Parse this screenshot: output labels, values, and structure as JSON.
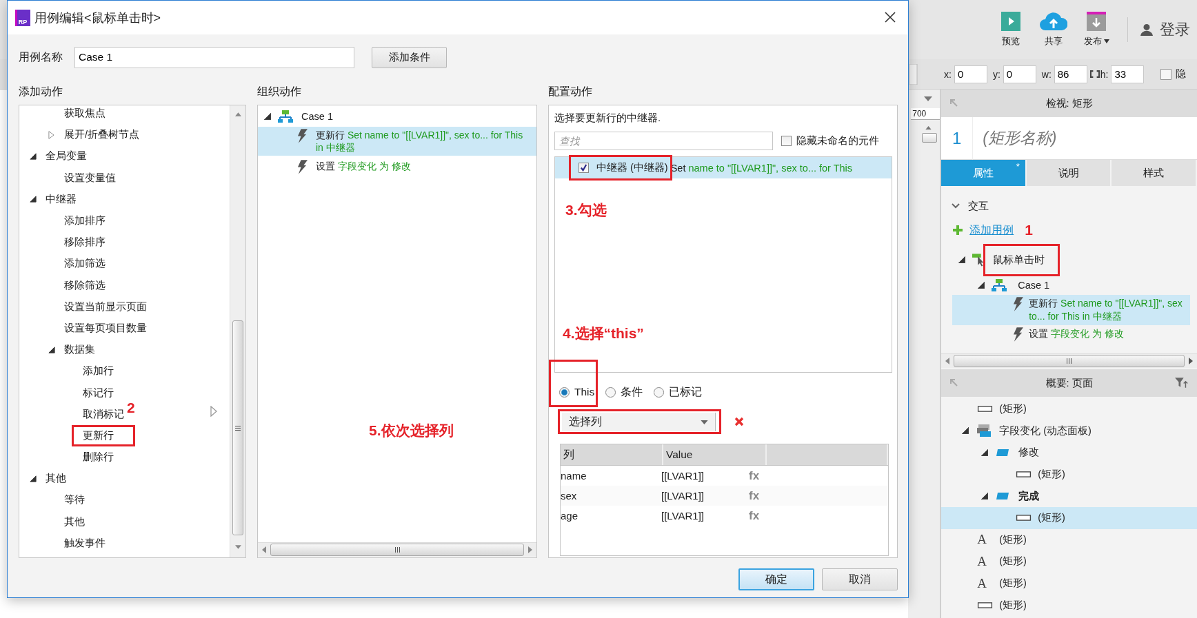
{
  "dialog": {
    "logo": "RP",
    "title": "用例编辑<鼠标单击时>",
    "name_label": "用例名称",
    "name_value": "Case 1",
    "add_condition": "添加条件",
    "add_actions": {
      "header": "添加动作",
      "tree": [
        {
          "children": [
            {
              "label": "获取焦点"
            },
            {
              "label": "展开/折叠树节点",
              "expanded": false
            }
          ]
        },
        {
          "label": "全局变量",
          "expanded": true,
          "children": [
            {
              "label": "设置变量值"
            }
          ]
        },
        {
          "label": "中继器",
          "expanded": true,
          "children": [
            {
              "label": "添加排序"
            },
            {
              "label": "移除排序"
            },
            {
              "label": "添加筛选"
            },
            {
              "label": "移除筛选"
            },
            {
              "label": "设置当前显示页面"
            },
            {
              "label": "设置每页项目数量"
            },
            {
              "label": "数据集",
              "expanded": true,
              "children": [
                {
                  "label": "添加行",
                  "marked": false
                },
                {
                  "label": "标记行",
                  "marked": false
                },
                {
                  "label": "取消标记",
                  "marked": false,
                  "callout": "2"
                },
                {
                  "label": "更新行",
                  "marked": true
                },
                {
                  "label": "删除行",
                  "marked": false
                }
              ]
            }
          ]
        },
        {
          "label": "其他",
          "expanded": true,
          "children": [
            {
              "label": "等待"
            },
            {
              "label": "其他"
            },
            {
              "label": "触发事件"
            }
          ]
        }
      ]
    },
    "organize": {
      "header": "组织动作",
      "case": {
        "label": "Case 1",
        "expanded": true,
        "actions": [
          {
            "verb": "更新行",
            "detail": "Set name to \"[[LVAR1]]\", sex to... for This in 中继器",
            "selected": true
          },
          {
            "verb": "设置",
            "detail": "字段变化 为 修改",
            "selected": false
          }
        ]
      }
    },
    "configure": {
      "header": "配置动作",
      "prompt": "选择要更新行的中继器.",
      "search": {
        "placeholder": "查找"
      },
      "hide_unnamed": {
        "label": "隐藏未命名的元件",
        "checked": false
      },
      "targets": [
        {
          "name": "中继器 (中继器)",
          "verb": "Set",
          "detail": "name to \"[[LVAR1]]\", sex to... for This",
          "checked": true,
          "selected": true,
          "marked": true
        }
      ],
      "scope": [
        {
          "label": "This",
          "selected": true,
          "marked": true
        },
        {
          "label": "条件",
          "selected": false,
          "marked": false
        },
        {
          "label": "已标记",
          "selected": false,
          "marked": false
        }
      ],
      "column_select": {
        "value": "选择列",
        "marked": true
      },
      "table": {
        "columns": [
          "列",
          "Value"
        ],
        "rows": [
          {
            "column": "name",
            "value": "[[LVAR1]]",
            "fx": "fx"
          },
          {
            "column": "sex",
            "value": "[[LVAR1]]",
            "fx": "fx"
          },
          {
            "column": "age",
            "value": "[[LVAR1]]",
            "fx": "fx"
          }
        ]
      }
    },
    "buttons": [
      {
        "label": "确定",
        "primary": true
      },
      {
        "label": "取消",
        "primary": false
      }
    ],
    "annotations": [
      "3.勾选",
      "4.选择“this”",
      "5.依次选择列"
    ]
  },
  "app": {
    "toolbar": [
      {
        "label": "预览",
        "kind": "preview",
        "menu": false
      },
      {
        "label": "共享",
        "kind": "share",
        "menu": false
      },
      {
        "label": "发布",
        "kind": "publish",
        "menu": true
      }
    ],
    "login": "登录",
    "geometry": [
      {
        "label": "x:",
        "value": "0",
        "lock": false
      },
      {
        "label": "y:",
        "value": "0",
        "lock": false
      },
      {
        "label": "w:",
        "value": "86",
        "lock": false
      },
      {
        "label": "h:",
        "value": "33",
        "lock": true
      }
    ],
    "hidden": {
      "label": "隐",
      "checked": false
    },
    "ruler": "700",
    "inspector": {
      "title": "检视: 矩形",
      "index": "1",
      "name_placeholder": "(矩形名称)",
      "tabs": [
        {
          "label": "属性",
          "selected": true,
          "badge": "*"
        },
        {
          "label": "说明",
          "selected": false
        },
        {
          "label": "样式",
          "selected": false
        }
      ],
      "section": {
        "label": "交互",
        "expanded": true
      },
      "add_case": {
        "label": "添加用例",
        "callout": "1"
      },
      "event": {
        "label": "鼠标单击时",
        "expanded": true,
        "marked": true,
        "cases": [
          {
            "label": "Case 1",
            "expanded": true,
            "actions": [
              {
                "verb": "更新行",
                "detail": "Set name to \"[[LVAR1]]\", sex to... for This in 中继器",
                "selected": true
              },
              {
                "verb": "设置",
                "detail": "字段变化 为 修改",
                "selected": false
              }
            ]
          }
        ]
      }
    },
    "outline": {
      "title": "概要: 页面",
      "items": [
        {
          "label": "(矩形)",
          "kind": "rect",
          "selected": false
        },
        {
          "label": "字段变化 (动态面板)",
          "kind": "panel",
          "expanded": true,
          "selected": false,
          "children": [
            {
              "label": "修改",
              "kind": "state",
              "expanded": true,
              "active": false,
              "selected": false,
              "children": [
                {
                  "label": "(矩形)",
                  "kind": "rect",
                  "selected": false
                }
              ]
            },
            {
              "label": "完成",
              "kind": "state",
              "expanded": true,
              "active": true,
              "selected": false,
              "children": [
                {
                  "label": "(矩形)",
                  "kind": "rect",
                  "selected": true
                }
              ]
            }
          ]
        },
        {
          "label": "(矩形)",
          "kind": "text",
          "icon": "A",
          "selected": false
        },
        {
          "label": "(矩形)",
          "kind": "text",
          "icon": "A",
          "selected": false
        },
        {
          "label": "(矩形)",
          "kind": "text",
          "icon": "A",
          "selected": false
        },
        {
          "label": "(矩形)",
          "kind": "rect",
          "selected": false
        }
      ]
    }
  }
}
